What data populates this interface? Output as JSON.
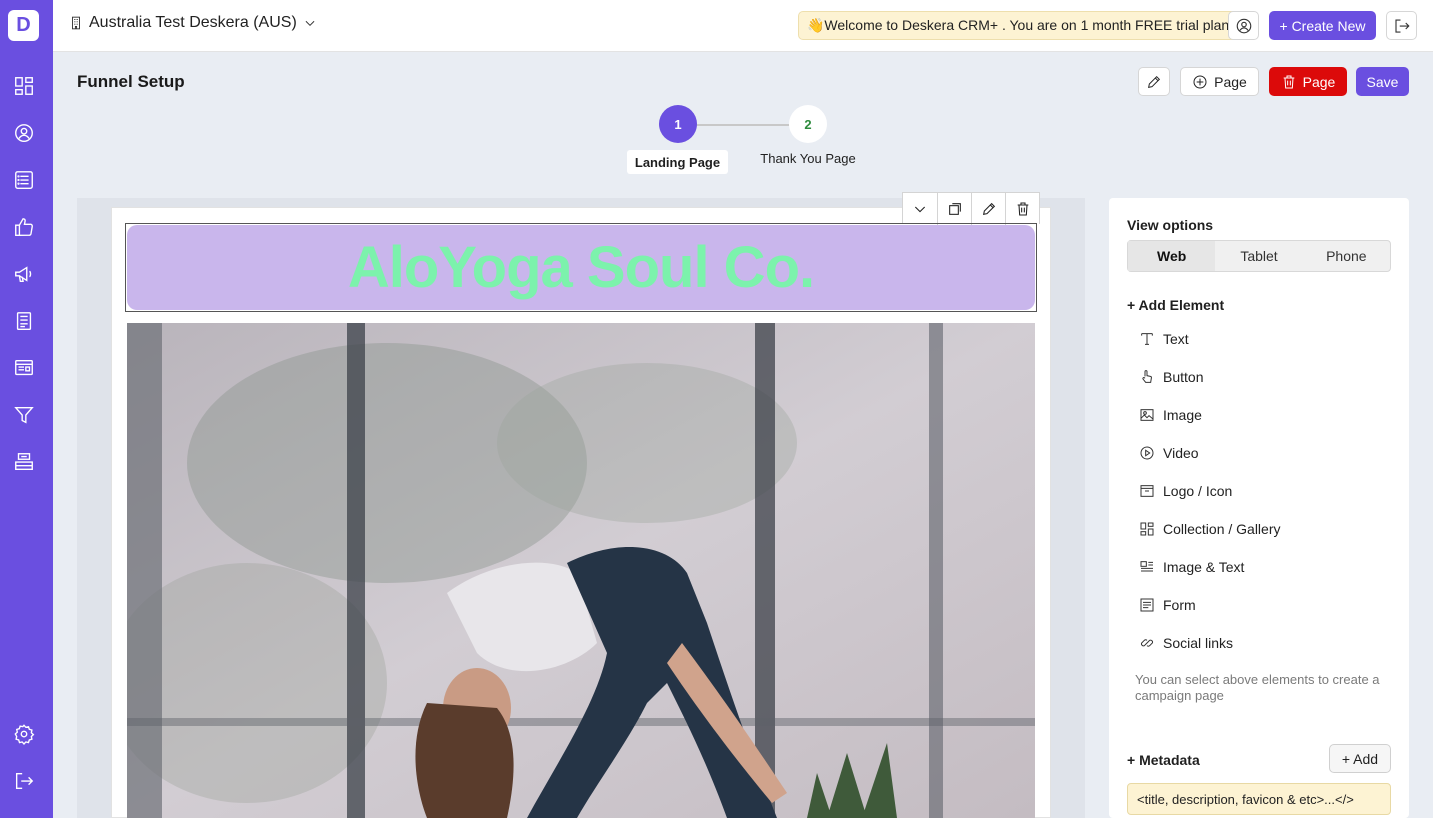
{
  "app": {
    "logo_letter": "D",
    "org_name": "Australia Test Deskera (AUS)",
    "banner": "👋Welcome to Deskera CRM+ . You are on 1 month FREE trial plan.",
    "create_new_label": "+ Create New",
    "accent_color": "#6a4fe0"
  },
  "sidebar": {
    "items": [
      {
        "name": "dashboard",
        "icon": "dashboard-icon"
      },
      {
        "name": "contacts",
        "icon": "contact-icon"
      },
      {
        "name": "list",
        "icon": "list-icon"
      },
      {
        "name": "deals",
        "icon": "thumbs-up-icon"
      },
      {
        "name": "campaigns",
        "icon": "megaphone-icon"
      },
      {
        "name": "forms",
        "icon": "form-icon"
      },
      {
        "name": "landing-pages",
        "icon": "page-icon"
      },
      {
        "name": "funnels",
        "icon": "funnel-icon"
      },
      {
        "name": "store",
        "icon": "store-icon"
      }
    ],
    "bottom": [
      {
        "name": "settings",
        "icon": "gear-icon"
      },
      {
        "name": "logout",
        "icon": "logout-icon"
      }
    ]
  },
  "header": {
    "title": "Funnel Setup",
    "add_page_label": "Page",
    "delete_page_label": "Page",
    "save_label": "Save"
  },
  "steps": [
    {
      "number": "1",
      "label": "Landing Page",
      "active": true
    },
    {
      "number": "2",
      "label": "Thank You Page",
      "active": false
    }
  ],
  "canvas": {
    "brand_text": "AloYoga Soul Co.",
    "brand_bg": "#c9b6ec",
    "brand_color": "#7cf2ac"
  },
  "panel": {
    "view_options_title": "View options",
    "views": [
      "Web",
      "Tablet",
      "Phone"
    ],
    "active_view": "Web",
    "add_element_title": "+ Add Element",
    "elements": [
      {
        "label": "Text",
        "icon": "text-icon"
      },
      {
        "label": "Button",
        "icon": "pointer-icon"
      },
      {
        "label": "Image",
        "icon": "image-icon"
      },
      {
        "label": "Video",
        "icon": "play-icon"
      },
      {
        "label": "Logo / Icon",
        "icon": "logo-icon"
      },
      {
        "label": "Collection / Gallery",
        "icon": "gallery-icon"
      },
      {
        "label": "Image & Text",
        "icon": "image-text-icon"
      },
      {
        "label": "Form",
        "icon": "form-icon"
      },
      {
        "label": "Social links",
        "icon": "link-icon"
      }
    ],
    "hint": "You can select above elements to create a campaign page",
    "metadata_title": "+ Metadata",
    "metadata_add_label": "+ Add",
    "metadata_value": "<title, description, favicon & etc>...</>"
  }
}
